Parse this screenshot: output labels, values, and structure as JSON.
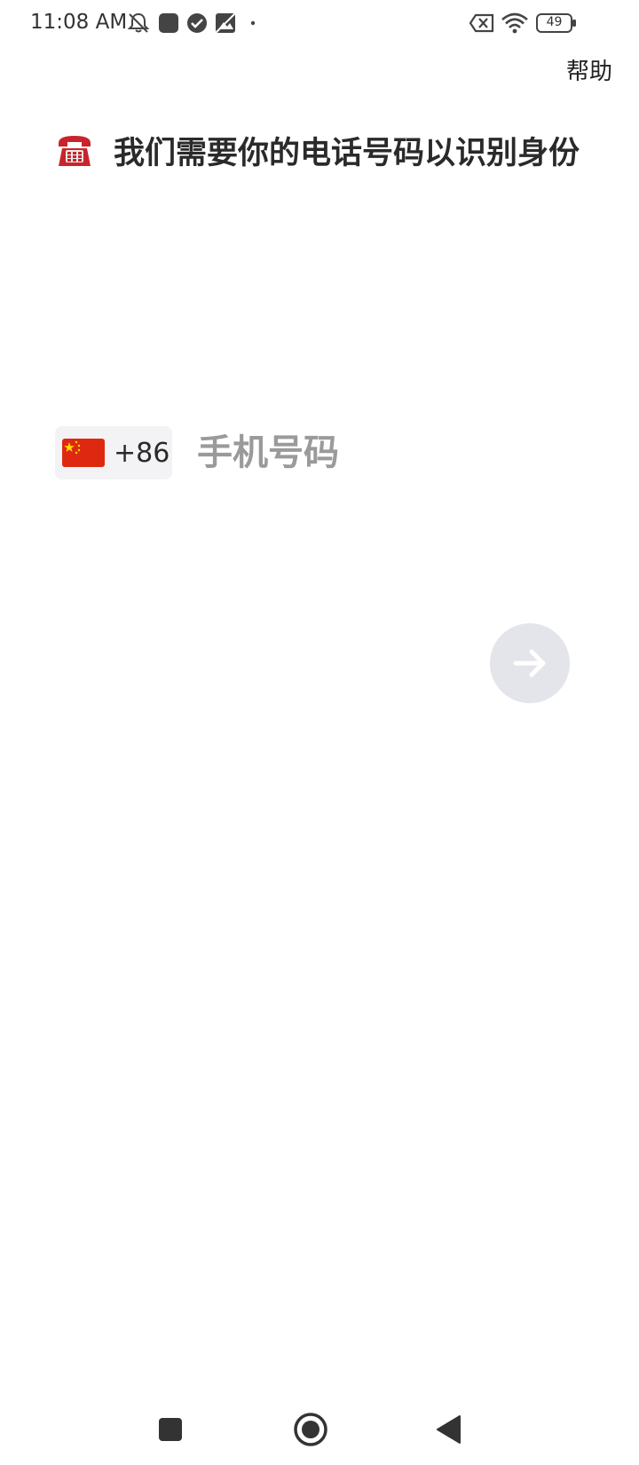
{
  "status_bar": {
    "time": "11:08 AM",
    "battery_level": "49",
    "icons": [
      "silent-mode-icon",
      "app-notification-icon",
      "check-circle-icon",
      "image-notification-icon",
      "dot-icon",
      "no-sim-icon",
      "wifi-icon",
      "battery-icon"
    ]
  },
  "header": {
    "help_label": "帮助"
  },
  "prompt": {
    "emoji": "telephone-icon",
    "title": "我们需要你的电话号码以识别身份"
  },
  "phone_form": {
    "country_flag": "china-flag-icon",
    "country_code": "+86",
    "phone_value": "",
    "phone_placeholder": "手机号码",
    "next_icon": "arrow-right-icon"
  },
  "nav_bar": {
    "items": [
      "recents-square-icon",
      "home-circle-icon",
      "back-triangle-icon"
    ]
  },
  "colors": {
    "background": "#ffffff",
    "chip_background": "#f3f3f5",
    "next_button_disabled": "#e3e5ea",
    "placeholder": "#9a9a9a",
    "flag_red": "#de2910",
    "flag_yellow": "#ffde00"
  }
}
